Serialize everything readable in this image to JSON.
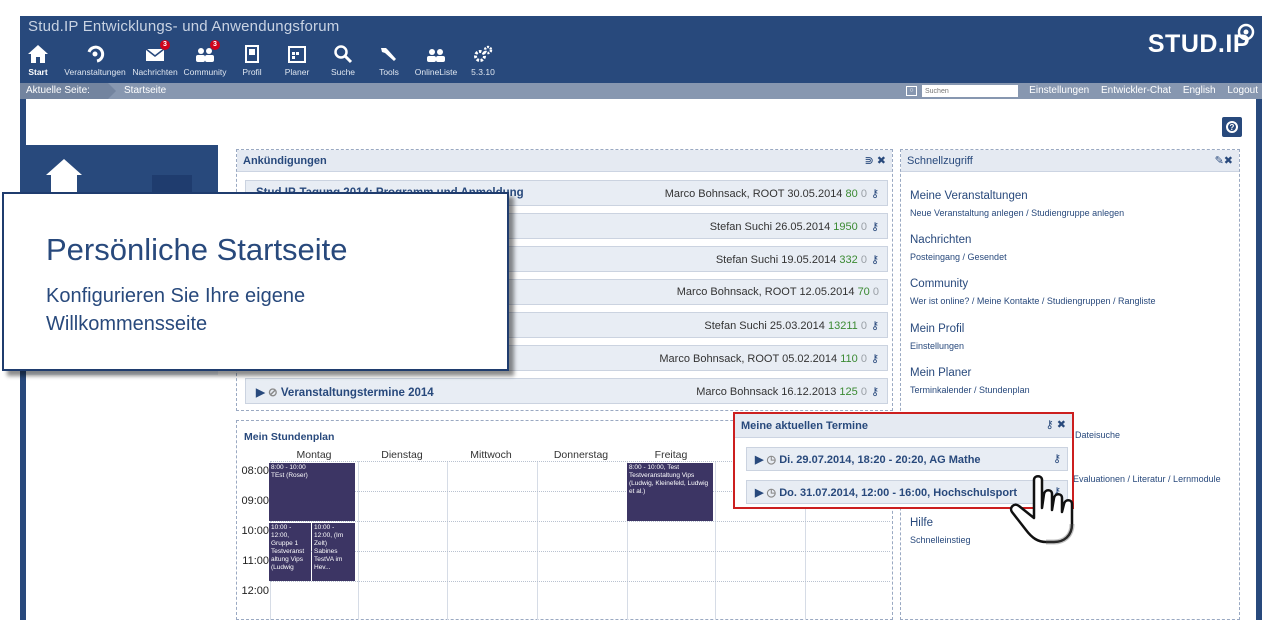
{
  "header": {
    "site_title": "Stud.IP Entwicklungs- und Anwendungsforum",
    "logo_text": "STUD.IP",
    "nav": [
      {
        "label": "Start",
        "icon": "home-icon"
      },
      {
        "label": "Veranstaltungen",
        "icon": "seminar-icon"
      },
      {
        "label": "Nachrichten",
        "icon": "mail-icon",
        "badge": "3"
      },
      {
        "label": "Community",
        "icon": "community-icon",
        "badge": "3"
      },
      {
        "label": "Profil",
        "icon": "profile-icon"
      },
      {
        "label": "Planer",
        "icon": "calendar-icon"
      },
      {
        "label": "Suche",
        "icon": "search-icon"
      },
      {
        "label": "Tools",
        "icon": "tools-icon"
      },
      {
        "label": "OnlineListe",
        "icon": "online-icon"
      },
      {
        "label": "5.3.10",
        "icon": "gears-icon"
      }
    ]
  },
  "subbar": {
    "crumb_label": "Aktuelle Seite:",
    "crumb_current": "Startseite",
    "search_placeholder": "Suchen",
    "links": [
      "Einstellungen",
      "Entwickler-Chat",
      "English",
      "Logout"
    ]
  },
  "announcements": {
    "title": "Ankündigungen",
    "rows": [
      {
        "title": "Stud.IP-Tagung 2014: Programm und Anmeldung",
        "author": "Marco Bohnsack, ROOT",
        "date": "30.05.2014",
        "views": "80",
        "comments": "0"
      },
      {
        "title": "",
        "author": "Stefan Suchi",
        "date": "26.05.2014",
        "views": "1950",
        "comments": "0"
      },
      {
        "title": "",
        "author": "Stefan Suchi",
        "date": "19.05.2014",
        "views": "332",
        "comments": "0"
      },
      {
        "title": "",
        "author": "Marco Bohnsack, ROOT",
        "date": "12.05.2014",
        "views": "70",
        "comments": "0"
      },
      {
        "title": "",
        "author": "Stefan Suchi",
        "date": "25.03.2014",
        "views": "13211",
        "comments": "0"
      },
      {
        "title": "",
        "author": "Marco Bohnsack, ROOT",
        "date": "05.02.2014",
        "views": "110",
        "comments": "0"
      },
      {
        "title": "Veranstaltungstermine 2014",
        "author": "Marco Bohnsack",
        "date": "16.12.2013",
        "views": "125",
        "comments": "0"
      }
    ]
  },
  "schedule": {
    "title": "Mein Stundenplan",
    "days": [
      "Montag",
      "Dienstag",
      "Mittwoch",
      "Donnerstag",
      "Freitag"
    ],
    "hours": [
      "08:00",
      "09:00",
      "10:00",
      "11:00",
      "12:00"
    ],
    "events": [
      {
        "text": "8:00 - 10:00\nTEst (Roser)"
      },
      {
        "text": "10:00 - 12:00,\nGruppe 1\nTestveranst altung Vips (Ludwig"
      },
      {
        "text": "10:00 - 12:00, (Im Zelt)\nSabines TestVA im Hev..."
      },
      {
        "text": "8:00 - 10:00, Test\nTestveranstaltung Vips (Ludwig, Kleinefeld, Ludwig et al.)"
      }
    ]
  },
  "quickaccess": {
    "title": "Schnellzugriff",
    "sections": [
      {
        "heading": "Meine Veranstaltungen",
        "links": "Neue Veranstaltung anlegen / Studiengruppe anlegen"
      },
      {
        "heading": "Nachrichten",
        "links": "Posteingang / Gesendet"
      },
      {
        "heading": "Community",
        "links": "Wer ist online? / Meine Kontakte / Studiengruppen / Rangliste"
      },
      {
        "heading": "Mein Profil",
        "links": "Einstellungen"
      },
      {
        "heading": "Mein Planer",
        "links": "Terminkalender / Stundenplan"
      },
      {
        "heading": "",
        "links": "Dateisuche"
      },
      {
        "heading": "",
        "links": "Evaluationen / Literatur / Lernmodule"
      },
      {
        "heading": "Hilfe",
        "links": "Schnelleinstieg"
      }
    ]
  },
  "termine": {
    "title": "Meine aktuellen Termine",
    "rows": [
      {
        "title": "Di. 29.07.2014, 18:20 - 20:20, AG Mathe"
      },
      {
        "title": "Do. 31.07.2014, 12:00 - 16:00, Hochschulsport"
      }
    ]
  },
  "callout": {
    "title": "Persönliche Startseite",
    "text": "Konfigurieren Sie Ihre eigene Willkommensseite"
  },
  "colors": {
    "brand": "#28497c",
    "highlight": "#cc1f1f",
    "count": "#3b8a33"
  }
}
